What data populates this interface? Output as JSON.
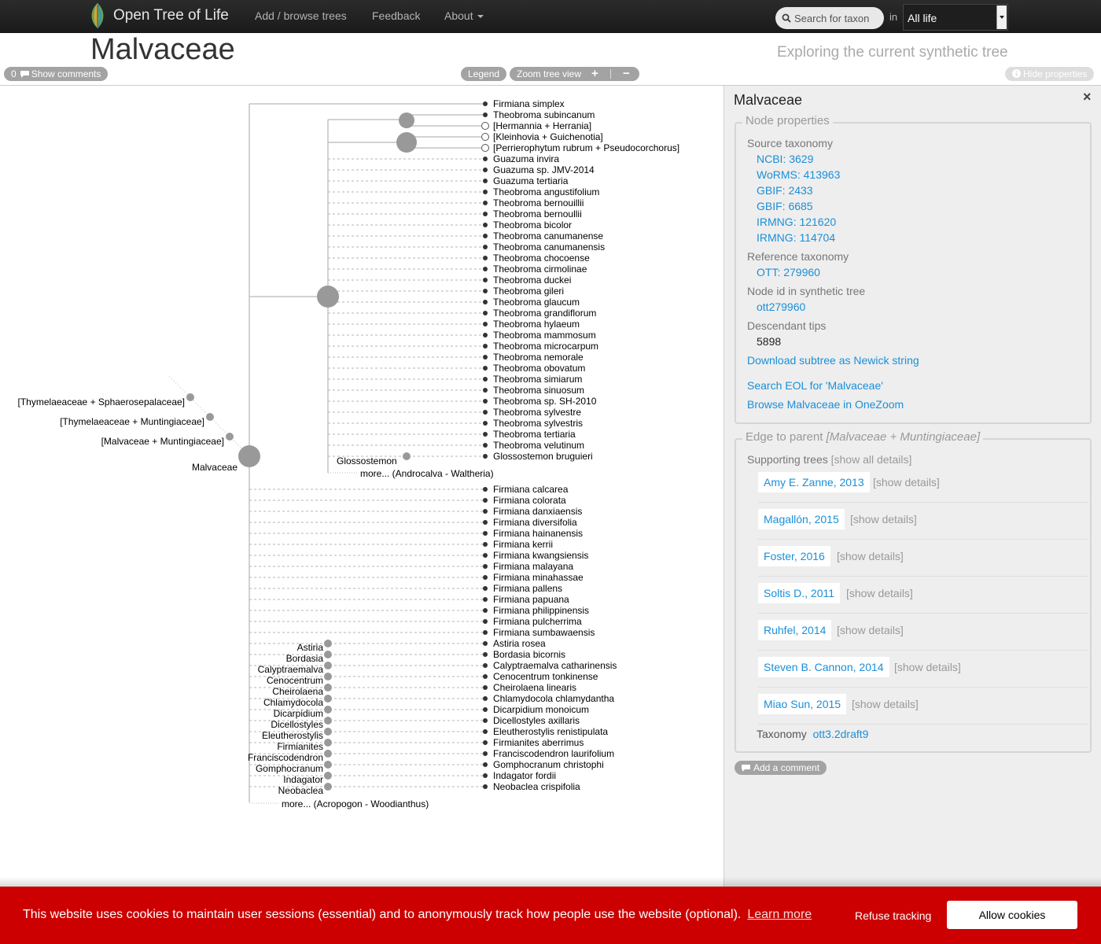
{
  "nav": {
    "brand": "Open Tree of Life",
    "links": [
      "Add / browse trees",
      "Feedback",
      "About"
    ],
    "search_label": "Search for taxon",
    "in_label": "in",
    "scope": "All life"
  },
  "header": {
    "title": "Malvaceae",
    "subtitle": "Exploring the current synthetic tree",
    "comments_count": "0",
    "show_comments": "Show comments",
    "legend": "Legend",
    "zoom_label": "Zoom tree view",
    "hide_properties": "Hide properties"
  },
  "tree": {
    "ancestors": [
      "[Thymelaeaceae + Sphaerosepalaceae]",
      "[Thymelaeaceae + Muntingiaceae]",
      "[Malvaceae + Muntingiaceae]"
    ],
    "focal": "Malvaceae",
    "top_tips": [
      {
        "label": "Firmiana simplex",
        "open": false
      },
      {
        "label": "Theobroma subincanum",
        "open": false
      },
      {
        "label": "[Hermannia + Herrania]",
        "open": true
      },
      {
        "label": "[Kleinhovia + Guichenotia]",
        "open": true
      },
      {
        "label": "[Perrierophytum rubrum + Pseudocorchorus]",
        "open": true
      },
      {
        "label": "Guazuma invira",
        "open": false
      },
      {
        "label": "Guazuma sp. JMV-2014",
        "open": false
      },
      {
        "label": "Guazuma tertiaria",
        "open": false
      },
      {
        "label": "Theobroma angustifolium",
        "open": false
      },
      {
        "label": "Theobroma bernouillii",
        "open": false
      },
      {
        "label": "Theobroma bernoullii",
        "open": false
      },
      {
        "label": "Theobroma bicolor",
        "open": false
      },
      {
        "label": "Theobroma canumanense",
        "open": false
      },
      {
        "label": "Theobroma canumanensis",
        "open": false
      },
      {
        "label": "Theobroma chocoense",
        "open": false
      },
      {
        "label": "Theobroma cirmolinae",
        "open": false
      },
      {
        "label": "Theobroma duckei",
        "open": false
      },
      {
        "label": "Theobroma gileri",
        "open": false
      },
      {
        "label": "Theobroma glaucum",
        "open": false
      },
      {
        "label": "Theobroma grandiflorum",
        "open": false
      },
      {
        "label": "Theobroma hylaeum",
        "open": false
      },
      {
        "label": "Theobroma mammosum",
        "open": false
      },
      {
        "label": "Theobroma microcarpum",
        "open": false
      },
      {
        "label": "Theobroma nemorale",
        "open": false
      },
      {
        "label": "Theobroma obovatum",
        "open": false
      },
      {
        "label": "Theobroma simiarum",
        "open": false
      },
      {
        "label": "Theobroma sinuosum",
        "open": false
      },
      {
        "label": "Theobroma sp. SH-2010",
        "open": false
      },
      {
        "label": "Theobroma sylvestre",
        "open": false
      },
      {
        "label": "Theobroma sylvestris",
        "open": false
      },
      {
        "label": "Theobroma tertiaria",
        "open": false
      },
      {
        "label": "Theobroma velutinum",
        "open": false
      },
      {
        "label": "Glossostemon bruguieri",
        "open": false
      }
    ],
    "glossostemon_genus": "Glossostemon",
    "more_top": "more... (Androcalva - Waltheria)",
    "firmiana_tips": [
      "Firmiana calcarea",
      "Firmiana colorata",
      "Firmiana danxiaensis",
      "Firmiana diversifolia",
      "Firmiana hainanensis",
      "Firmiana kerrii",
      "Firmiana kwangsiensis",
      "Firmiana malayana",
      "Firmiana minahassae",
      "Firmiana pallens",
      "Firmiana papuana",
      "Firmiana philippinensis",
      "Firmiana pulcherrima",
      "Firmiana sumbawaensis"
    ],
    "genus_pairs": [
      {
        "genus": "Astiria",
        "species": "Astiria rosea"
      },
      {
        "genus": "Bordasia",
        "species": "Bordasia bicornis"
      },
      {
        "genus": "Calyptraemalva",
        "species": "Calyptraemalva catharinensis"
      },
      {
        "genus": "Cenocentrum",
        "species": "Cenocentrum tonkinense"
      },
      {
        "genus": "Cheirolaena",
        "species": "Cheirolaena linearis"
      },
      {
        "genus": "Chlamydocola",
        "species": "Chlamydocola chlamydantha"
      },
      {
        "genus": "Dicarpidium",
        "species": "Dicarpidium monoicum"
      },
      {
        "genus": "Dicellostyles",
        "species": "Dicellostyles axillaris"
      },
      {
        "genus": "Eleutherostylis",
        "species": "Eleutherostylis renistipulata"
      },
      {
        "genus": "Firmianites",
        "species": "Firmianites aberrimus"
      },
      {
        "genus": "Franciscodendron",
        "species": "Franciscodendron laurifolium"
      },
      {
        "genus": "Gomphocranum",
        "species": "Gomphocranum christophi"
      },
      {
        "genus": "Indagator",
        "species": "Indagator fordii"
      },
      {
        "genus": "Neobaclea",
        "species": "Neobaclea crispifolia"
      }
    ],
    "more_bottom": "more... (Acropogon - Woodianthus)"
  },
  "panel": {
    "title": "Malvaceae",
    "close": "×",
    "node_legend": "Node properties",
    "source_taxonomy_label": "Source taxonomy",
    "source_taxonomy": [
      "NCBI: 3629",
      "WoRMS: 413963",
      "GBIF: 2433",
      "GBIF: 6685",
      "IRMNG: 121620",
      "IRMNG: 114704"
    ],
    "ref_taxonomy_label": "Reference taxonomy",
    "ref_taxonomy": "OTT: 279960",
    "node_id_label": "Node id in synthetic tree",
    "node_id": "ott279960",
    "desc_tips_label": "Descendant tips",
    "desc_tips": "5898",
    "download": "Download subtree as Newick string",
    "search_eol": "Search EOL for 'Malvaceae'",
    "onezoom": "Browse Malvaceae in OneZoom",
    "edge_legend_prefix": "Edge to parent",
    "edge_legend_node": "[Malvaceae + Muntingiaceae]",
    "supporting_label": "Supporting trees",
    "show_all": "[show all details]",
    "trees": [
      "Amy E. Zanne, 2013",
      "Magallón, 2015",
      "Foster, 2016",
      "Soltis D., 2011",
      "Ruhfel, 2014",
      "Steven B. Cannon, 2014",
      "Miao Sun, 2015"
    ],
    "show_details": "[show details]",
    "taxonomy_label": "Taxonomy",
    "taxonomy_value": "ott3.2draft9",
    "add_comment": "Add a comment"
  },
  "cookie": {
    "message": "This website uses cookies to maintain user sessions (essential) and to anonymously track how people use the website (optional).",
    "learn_more": "Learn more",
    "refuse": "Refuse tracking",
    "allow": "Allow cookies"
  }
}
